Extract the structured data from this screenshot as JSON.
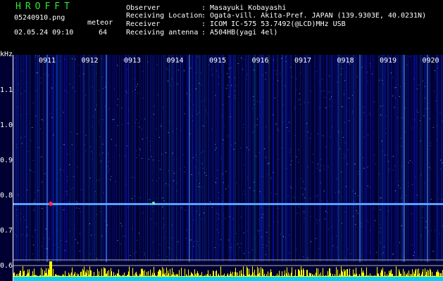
{
  "app": {
    "title": "HROFFT"
  },
  "info": {
    "filename": "05240910.png",
    "datetime": "02.05.24 09:10",
    "meteor_label": "meteor",
    "meteor_count": "64"
  },
  "station": {
    "observer_label": "Observer",
    "observer_value": ": Masayuki Kobayashi",
    "location_label": "Receiving Location",
    "location_value": ": Ogata-vill. Akita-Pref. JAPAN (139.9303E, 40.0231N)",
    "receiver_label": "Receiver",
    "receiver_value": ": ICOM IC-575 53.7492(@LCD)MHz USB",
    "antenna_label": "Receiving antenna",
    "antenna_value": ": A504HB(yagi 4el)"
  },
  "spectrogram": {
    "freq_unit": "kHz",
    "freq_ticks": [
      "1.1",
      "1.0",
      "0.9",
      "0.8",
      "0.7",
      "0.6"
    ],
    "time_ticks": [
      "0911",
      "0912",
      "0913",
      "0914",
      "0915",
      "0916",
      "0917",
      "0918",
      "0919",
      "0920"
    ],
    "colors": {
      "background": "#000033",
      "carrier": "#5aa0ff",
      "meter": "#ffff00",
      "meter_base": "#00d0ff"
    }
  }
}
